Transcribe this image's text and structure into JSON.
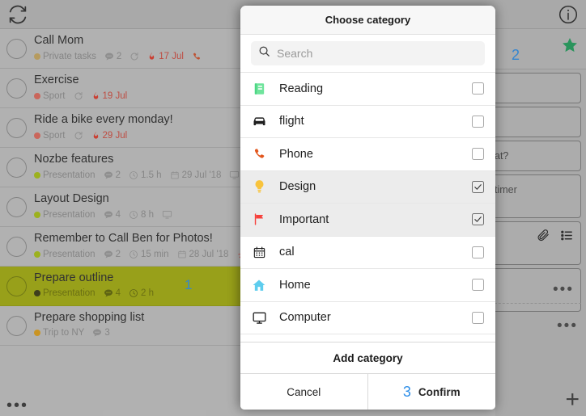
{
  "background": {
    "toolbar": {
      "refresh_icon": "refresh-sync-icon",
      "info_icon": "info-circle-icon"
    },
    "tasks": [
      {
        "title": "Call Mom",
        "project": "Private tasks",
        "project_color": "#c9a961",
        "comments": "2",
        "has_repeat": true,
        "due": "17 Jul",
        "trailing_icon": "phone-icon",
        "highlight": false,
        "annotation": ""
      },
      {
        "title": "Exercise",
        "project": "Sport",
        "project_color": "#e0695c",
        "comments": "",
        "has_repeat": true,
        "due": "19 Jul",
        "trailing_icon": "",
        "highlight": false,
        "annotation": ""
      },
      {
        "title": "Ride a bike every monday!",
        "project": "Sport",
        "project_color": "#e0695c",
        "comments": "",
        "has_repeat": true,
        "due": "29 Jul",
        "trailing_icon": "",
        "highlight": false,
        "annotation": ""
      },
      {
        "title": "Nozbe features",
        "project": "Presentation",
        "project_color": "#aac314",
        "comments": "2",
        "time": "1.5 h",
        "date": "29 Jul '18",
        "trailing_icon": "computer-icon",
        "highlight": false,
        "annotation": ""
      },
      {
        "title": "Layout Design",
        "project": "Presentation",
        "project_color": "#aac314",
        "comments": "4",
        "time": "8 h",
        "trailing_icon": "computer-icon",
        "highlight": false,
        "annotation": ""
      },
      {
        "title": "Remember to Call Ben for Photos!",
        "project": "Presentation",
        "project_color": "#aac314",
        "comments": "2",
        "time": "15 min",
        "date": "28 Jul '18",
        "trailing_icon": "runner-icon",
        "highlight": false,
        "annotation": ""
      },
      {
        "title": "Prepare outline",
        "project": "Presentation",
        "project_color": "#3a3a12",
        "comments": "4",
        "time": "2 h",
        "trailing_icon": "",
        "highlight": true,
        "annotation": "1"
      },
      {
        "title": "Prepare shopping list",
        "project": "Trip to NY",
        "project_color": "#e0a01a",
        "comments": "3",
        "trailing_icon": "",
        "highlight": false,
        "annotation": ""
      }
    ],
    "list_more_label": "•••",
    "detail": {
      "annotation": "2",
      "star_icon": "star-icon",
      "star_color": "#22a05e",
      "cards": [
        {
          "text": ""
        },
        {
          "text": ""
        },
        {
          "text": "at?"
        },
        {
          "text": "timer"
        }
      ],
      "attachment_icon": "paperclip-icon",
      "checklist_icon": "checklist-icon",
      "more_label": "•••",
      "add_label": "+"
    }
  },
  "modal": {
    "title": "Choose category",
    "search": {
      "placeholder": "Search",
      "value": "",
      "icon": "search-icon"
    },
    "categories": [
      {
        "label": "Reading",
        "icon": "book-icon",
        "icon_color": "#6fe49c",
        "checked": false
      },
      {
        "label": "flight",
        "icon": "car-icon",
        "icon_color": "#1f1f1f",
        "checked": false
      },
      {
        "label": "Phone",
        "icon": "phone-icon",
        "icon_color": "#e2571e",
        "checked": false
      },
      {
        "label": "Design",
        "icon": "bulb-icon",
        "icon_color": "#f8c33c",
        "checked": true
      },
      {
        "label": "Important",
        "icon": "flag-icon",
        "icon_color": "#f6413c",
        "checked": true
      },
      {
        "label": "cal",
        "icon": "calendar-icon",
        "icon_color": "#1f1f1f",
        "checked": false
      },
      {
        "label": "Home",
        "icon": "home-icon",
        "icon_color": "#5ecdee",
        "checked": false
      },
      {
        "label": "Computer",
        "icon": "computer-icon",
        "icon_color": "#1f1f1f",
        "checked": false
      }
    ],
    "add_category_label": "Add category",
    "cancel_label": "Cancel",
    "confirm_label": "Confirm",
    "confirm_annotation": "3",
    "annotation_color": "#2f8fe8"
  }
}
